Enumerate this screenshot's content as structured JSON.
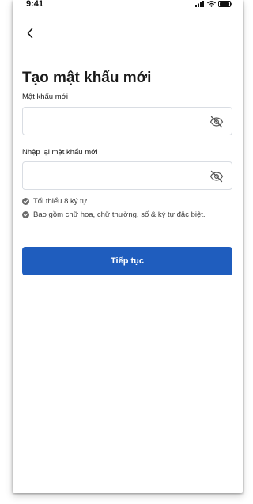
{
  "status_bar": {
    "time": "9:41"
  },
  "screen": {
    "title": "Tạo mật khẩu mới",
    "new_password": {
      "label": "Mật khẩu mới",
      "value": ""
    },
    "confirm_password": {
      "label": "Nhập lại mật khẩu mới",
      "value": ""
    },
    "rules": [
      {
        "text": "Tối thiểu 8 ký tự."
      },
      {
        "text": "Bao gồm chữ hoa, chữ thường, số & ký tự đặc biệt."
      }
    ],
    "continue_label": "Tiếp tục"
  },
  "colors": {
    "primary": "#1f5dbe",
    "check_icon": "#6b6b6b",
    "field_border": "#d9dde3"
  },
  "icons": {
    "back": "chevron-left-icon",
    "password_visibility": "eye-off-icon",
    "rule": "check-circle-icon"
  }
}
